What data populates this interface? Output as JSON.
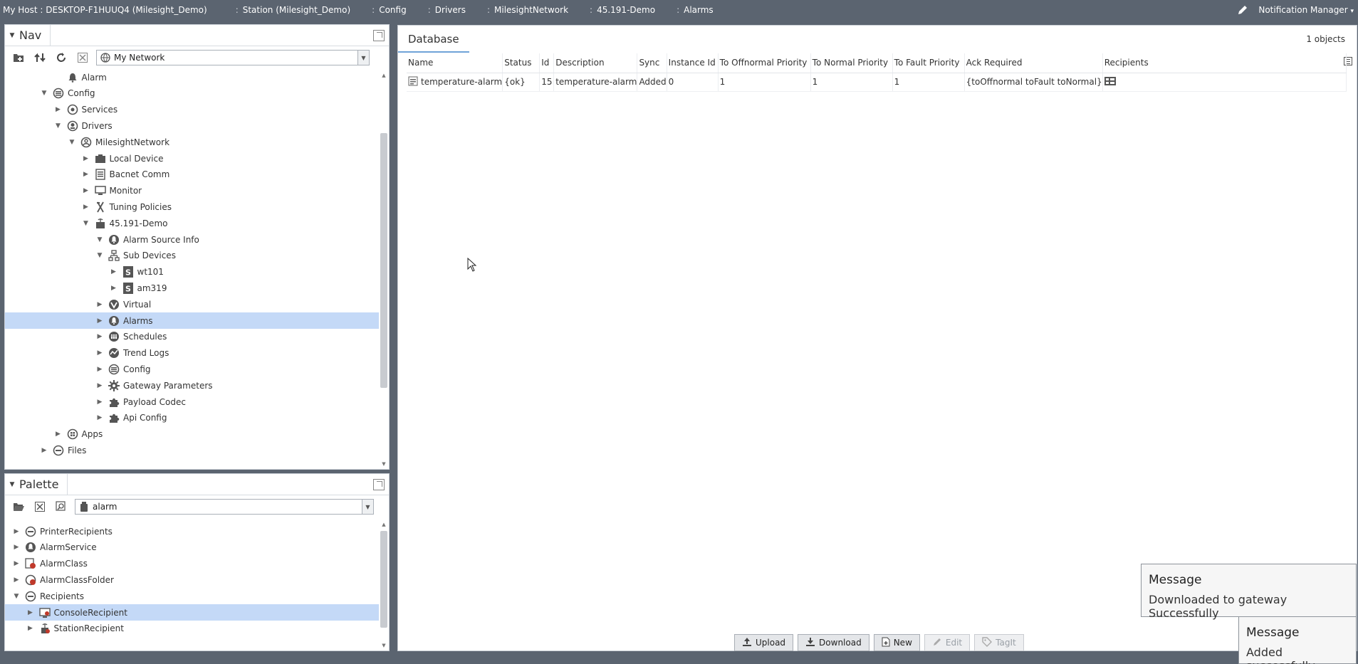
{
  "topbar": {
    "crumbs": [
      "My Host : DESKTOP-F1HUUQ4 (Milesight_Demo)",
      "Station (Milesight_Demo)",
      "Config",
      "Drivers",
      "MilesightNetwork",
      "45.191-Demo",
      "Alarms"
    ],
    "notification_manager": "Notification Manager"
  },
  "nav": {
    "title": "Nav",
    "network_combo": "My Network",
    "tree": [
      {
        "label": "Alarm",
        "icon": "bell-icon"
      },
      {
        "label": "Config",
        "icon": "config-icon"
      },
      {
        "label": "Services",
        "icon": "services-icon"
      },
      {
        "label": "Drivers",
        "icon": "drivers-icon"
      },
      {
        "label": "MilesightNetwork",
        "icon": "network-icon"
      },
      {
        "label": "Local Device",
        "icon": "local-device-icon"
      },
      {
        "label": "Bacnet Comm",
        "icon": "bacnet-icon"
      },
      {
        "label": "Monitor",
        "icon": "monitor-icon"
      },
      {
        "label": "Tuning Policies",
        "icon": "tuning-icon"
      },
      {
        "label": "45.191-Demo",
        "icon": "device-icon"
      },
      {
        "label": "Alarm Source Info",
        "icon": "alarm-source-icon"
      },
      {
        "label": "Sub Devices",
        "icon": "sub-devices-icon"
      },
      {
        "label": "wt101",
        "icon": "s-device-icon"
      },
      {
        "label": "am319",
        "icon": "s-device-icon"
      },
      {
        "label": "Virtual",
        "icon": "virtual-icon"
      },
      {
        "label": "Alarms",
        "icon": "alarms-icon"
      },
      {
        "label": "Schedules",
        "icon": "schedules-icon"
      },
      {
        "label": "Trend Logs",
        "icon": "trend-logs-icon"
      },
      {
        "label": "Config",
        "icon": "config-icon"
      },
      {
        "label": "Gateway Parameters",
        "icon": "gear-icon"
      },
      {
        "label": "Payload Codec",
        "icon": "puzzle-icon"
      },
      {
        "label": "Api Config",
        "icon": "puzzle-icon"
      },
      {
        "label": "Apps",
        "icon": "apps-icon"
      },
      {
        "label": "Files",
        "icon": "files-icon"
      }
    ]
  },
  "palette": {
    "title": "Palette",
    "module_combo": "alarm",
    "tree": [
      {
        "label": "PrinterRecipients",
        "icon": "folder-icon"
      },
      {
        "label": "AlarmService",
        "icon": "alarm-service-icon"
      },
      {
        "label": "AlarmClass",
        "icon": "alarm-class-icon"
      },
      {
        "label": "AlarmClassFolder",
        "icon": "alarm-class-folder-icon"
      },
      {
        "label": "Recipients",
        "icon": "folder-icon"
      },
      {
        "label": "ConsoleRecipient",
        "icon": "console-icon"
      },
      {
        "label": "StationRecipient",
        "icon": "station-icon"
      }
    ]
  },
  "database": {
    "tab": "Database",
    "count": "1 objects",
    "columns": [
      "Name",
      "Status",
      "Id",
      "Description",
      "Sync",
      "Instance Id",
      "To Offnormal Priority",
      "To Normal Priority",
      "To Fault Priority",
      "Ack Required",
      "Recipients"
    ],
    "rows": [
      [
        "temperature-alarm",
        "{ok}",
        "15",
        "temperature-alarm",
        "Added",
        "0",
        "1",
        "1",
        "1",
        "{toOffnormal toFault toNormal}",
        ""
      ]
    ]
  },
  "buttons": {
    "upload": "Upload",
    "download": "Download",
    "new": "New",
    "edit": "Edit",
    "tagit": "TagIt"
  },
  "toasts": [
    {
      "title": "Message",
      "text": "Downloaded to gateway Successfully"
    },
    {
      "title": "Message",
      "text": "Added successfully."
    }
  ],
  "colors": {
    "chrome": "#5b6470",
    "selection": "#c4d9f7",
    "tab_accent": "#6fa3d8"
  }
}
